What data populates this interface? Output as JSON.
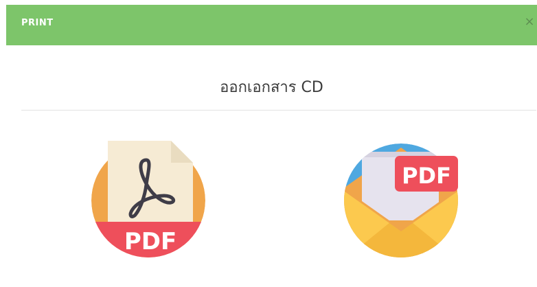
{
  "header": {
    "title": "PRINT",
    "close_label": "×"
  },
  "content": {
    "title": "ออกเอกสาร CD"
  },
  "options": [
    {
      "icon": "pdf-document-icon",
      "badge": "PDF"
    },
    {
      "icon": "email-pdf-icon",
      "badge": "PDF"
    }
  ],
  "colors": {
    "header_bg": "#7dc56a",
    "header_text": "#ffffff",
    "pdf_red": "#ee4f5b",
    "orange": "#f0a54a",
    "envelope_yellow": "#fcc94e",
    "circle_blue": "#4fa8e0"
  }
}
